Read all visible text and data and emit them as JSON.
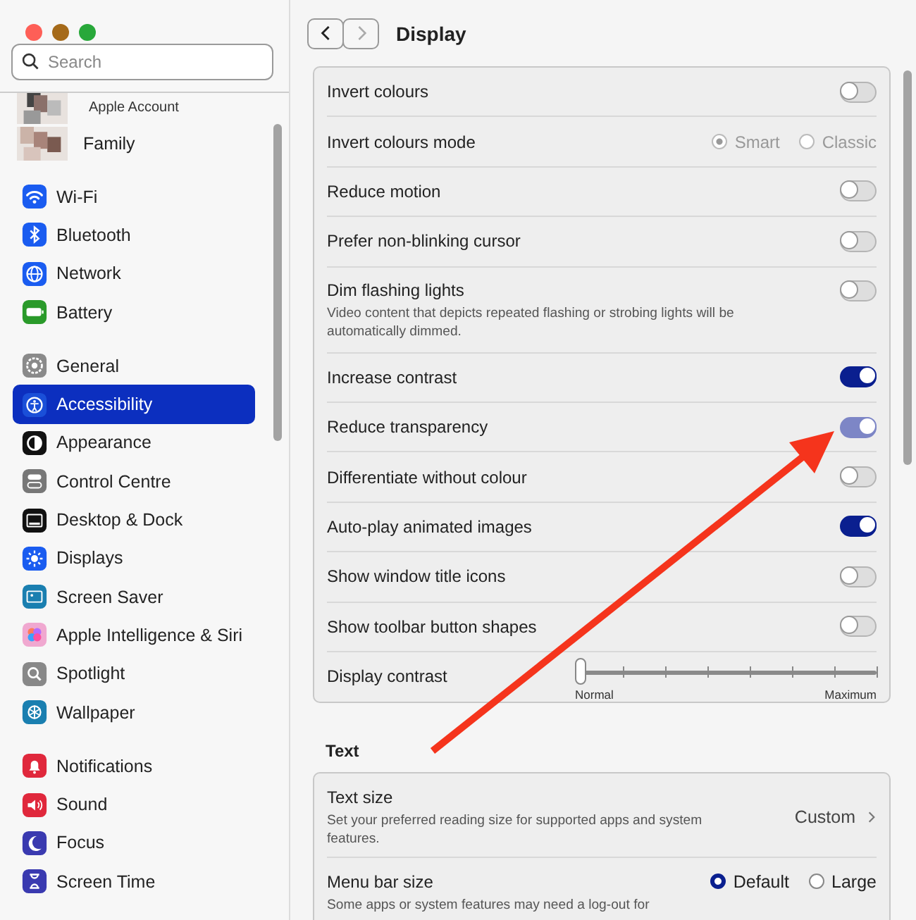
{
  "sidebar": {
    "search": {
      "placeholder": "Search"
    },
    "account": [
      {
        "label": "Apple Account",
        "kind": "small"
      },
      {
        "label": "Family",
        "kind": "normal"
      }
    ],
    "groups": [
      {
        "items": [
          {
            "label": "Wi-Fi",
            "selected": false
          },
          {
            "label": "Bluetooth",
            "selected": false
          },
          {
            "label": "Network",
            "selected": false
          },
          {
            "label": "Battery",
            "selected": false
          }
        ]
      },
      {
        "items": [
          {
            "label": "General",
            "selected": false
          },
          {
            "label": "Accessibility",
            "selected": true
          },
          {
            "label": "Appearance",
            "selected": false
          },
          {
            "label": "Control Centre",
            "selected": false
          },
          {
            "label": "Desktop & Dock",
            "selected": false
          },
          {
            "label": "Displays",
            "selected": false
          },
          {
            "label": "Screen Saver",
            "selected": false
          },
          {
            "label": "Apple Intelligence & Siri",
            "selected": false
          },
          {
            "label": "Spotlight",
            "selected": false
          },
          {
            "label": "Wallpaper",
            "selected": false
          }
        ]
      },
      {
        "items": [
          {
            "label": "Notifications",
            "selected": false
          },
          {
            "label": "Sound",
            "selected": false
          },
          {
            "label": "Focus",
            "selected": false
          },
          {
            "label": "Screen Time",
            "selected": false
          }
        ]
      }
    ]
  },
  "main": {
    "title": "Display",
    "rows": [
      {
        "kind": "toggle",
        "label": "Invert colours",
        "on": false,
        "disabled": false
      },
      {
        "kind": "radio",
        "label": "Invert colours mode",
        "options": [
          {
            "label": "Smart",
            "selected": true,
            "disabled": true
          },
          {
            "label": "Classic",
            "selected": false,
            "disabled": true
          }
        ]
      },
      {
        "kind": "toggle",
        "label": "Reduce motion",
        "on": false,
        "disabled": false
      },
      {
        "kind": "toggle",
        "label": "Prefer non-blinking cursor",
        "on": false,
        "disabled": false
      },
      {
        "kind": "toggle",
        "label": "Dim flashing lights",
        "description": "Video content that depicts repeated flashing or strobing lights will be automatically dimmed.",
        "on": false,
        "disabled": false
      },
      {
        "kind": "toggle",
        "label": "Increase contrast",
        "on": true,
        "disabled": false
      },
      {
        "kind": "toggle",
        "label": "Reduce transparency",
        "on": true,
        "disabled": true
      },
      {
        "kind": "toggle",
        "label": "Differentiate without colour",
        "on": false,
        "disabled": false
      },
      {
        "kind": "toggle",
        "label": "Auto-play animated images",
        "on": true,
        "disabled": false
      },
      {
        "kind": "toggle",
        "label": "Show window title icons",
        "on": false,
        "disabled": false
      },
      {
        "kind": "toggle",
        "label": "Show toolbar button shapes",
        "on": false,
        "disabled": false
      },
      {
        "kind": "slider",
        "label": "Display contrast",
        "level": 0,
        "min_label": "Normal",
        "max_label": "Maximum"
      }
    ],
    "section": "Text",
    "text_rows": [
      {
        "kind": "link",
        "label": "Text size",
        "description": "Set your preferred reading size for supported apps and system features.",
        "value": "Custom"
      },
      {
        "kind": "radio",
        "label": "Menu bar size",
        "description": "Some apps or system features may need a log-out for",
        "options": [
          {
            "label": "Default",
            "selected": true,
            "disabled": false
          },
          {
            "label": "Large",
            "selected": false,
            "disabled": false
          }
        ]
      }
    ]
  }
}
